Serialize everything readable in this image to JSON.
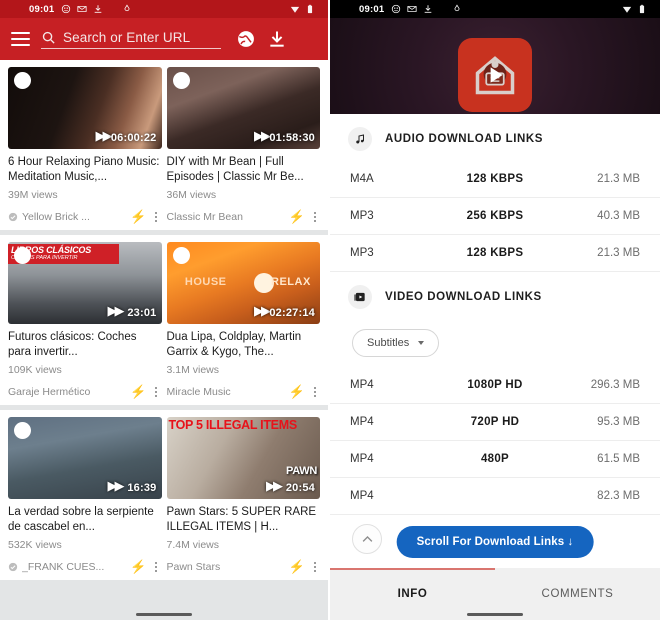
{
  "left": {
    "status_bar": {
      "time": "09:01",
      "icons": [
        "mask-icon",
        "mail-icon",
        "download-icon",
        "water-drop-icon"
      ],
      "right_icons": [
        "wifi-icon",
        "battery-icon"
      ]
    },
    "toolbar": {
      "menu_icon": "hamburger-menu-icon",
      "search_placeholder": "Search or Enter URL",
      "search_icon": "search-icon",
      "globe_icon": "globe-icon",
      "download_icon": "download-icon",
      "bg_color": "#c62024"
    },
    "videos": [
      {
        "title": "6 Hour Relaxing Piano Music: Meditation Music,...",
        "duration": "06:00:22",
        "views": "39M views",
        "channel": "Yellow Brick ...",
        "verified": true,
        "bolt_icon": "lightning-download-icon",
        "menu_icon": "kebab-menu-icon"
      },
      {
        "title": "DIY with Mr Bean | Full Episodes | Classic Mr Be...",
        "duration": "01:58:30",
        "views": "36M views",
        "channel": "Classic Mr Bean",
        "verified": false,
        "bolt_icon": "lightning-download-icon",
        "menu_icon": "kebab-menu-icon"
      },
      {
        "title": "Futuros clásicos: Coches para invertir...",
        "duration": "23:01",
        "views": "109K views",
        "channel": "Garaje Hermético",
        "verified": false,
        "bolt_icon": "lightning-download-icon",
        "menu_icon": "kebab-menu-icon",
        "thumb_text1": "LIBROS CLÁSICOS",
        "thumb_text2": "COCHES PARA INVERTIR"
      },
      {
        "title": "Dua Lipa, Coldplay, Martin Garrix & Kygo, The...",
        "duration": "02:27:14",
        "views": "3.1M views",
        "channel": "Miracle Music",
        "verified": false,
        "bolt_icon": "lightning-download-icon",
        "menu_icon": "kebab-menu-icon",
        "thumb_text1": "HOUSE",
        "thumb_text2": "RELAX"
      },
      {
        "title": "La verdad sobre la serpiente de cascabel en...",
        "duration": "16:39",
        "views": "532K views",
        "channel": "_FRANK CUES...",
        "verified": true,
        "bolt_icon": "lightning-download-icon",
        "menu_icon": "kebab-menu-icon"
      },
      {
        "title": "Pawn Stars: 5 SUPER RARE ILLEGAL ITEMS | H...",
        "duration": "20:54",
        "views": "7.4M views",
        "channel": "Pawn Stars",
        "verified": false,
        "bolt_icon": "lightning-download-icon",
        "menu_icon": "kebab-menu-icon",
        "thumb_text1": "TOP 5 ILLEGAL ITEMS",
        "thumb_text2": "PAWN"
      }
    ]
  },
  "right": {
    "status_bar": {
      "time": "09:01",
      "icons": [
        "mask-icon",
        "mail-icon",
        "download-icon",
        "water-drop-icon"
      ],
      "right_icons": [
        "wifi-icon",
        "battery-icon"
      ]
    },
    "player": {
      "logo_icon": "barn-play-app-logo",
      "play_icon": "play-icon",
      "logo_color": "#c8321f"
    },
    "audio_section": {
      "icon": "music-note-icon",
      "title": "AUDIO DOWNLOAD LINKS",
      "columns": [
        "format",
        "quality",
        "size"
      ],
      "rows": [
        {
          "format": "M4A",
          "quality": "128 KBPS",
          "size": "21.3 MB"
        },
        {
          "format": "MP3",
          "quality": "256 KBPS",
          "size": "40.3 MB"
        },
        {
          "format": "MP3",
          "quality": "128 KBPS",
          "size": "21.3 MB"
        }
      ]
    },
    "video_section": {
      "icon": "video-library-icon",
      "title": "VIDEO DOWNLOAD LINKS",
      "subtitles_label": "Subtitles",
      "columns": [
        "format",
        "quality",
        "size"
      ],
      "rows": [
        {
          "format": "MP4",
          "quality": "1080P HD",
          "size": "296.3 MB"
        },
        {
          "format": "MP4",
          "quality": "720P HD",
          "size": "95.3 MB"
        },
        {
          "format": "MP4",
          "quality": "480P",
          "size": "61.5 MB"
        },
        {
          "format": "MP4",
          "quality": "",
          "size": "82.3 MB"
        }
      ]
    },
    "fab": {
      "icon": "chevron-up-icon"
    },
    "scroll_button": {
      "label": "Scroll For Download Links ↓",
      "color": "#1565c0"
    },
    "tabs": [
      {
        "label": "INFO",
        "active": true
      },
      {
        "label": "COMMENTS",
        "active": false
      }
    ]
  }
}
